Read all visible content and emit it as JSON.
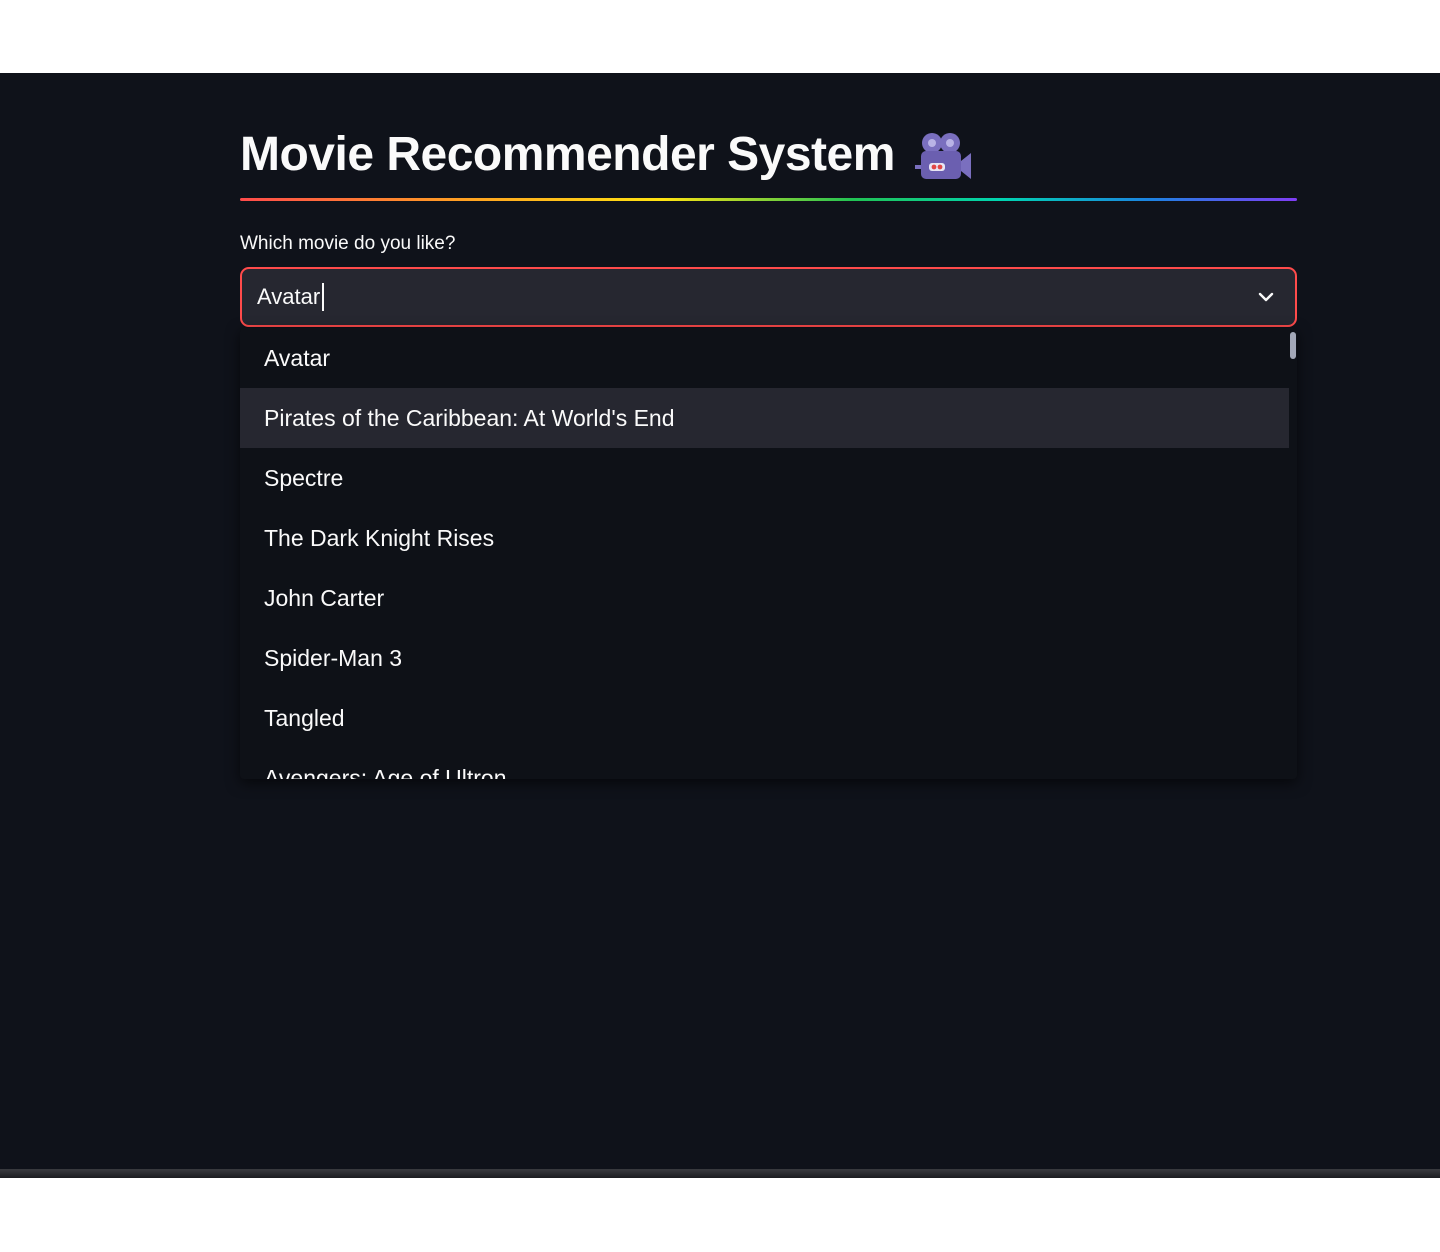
{
  "app": {
    "title": "Movie Recommender System",
    "title_icon": "movie-camera-icon"
  },
  "form": {
    "label": "Which movie do you like?",
    "selected_value": "Avatar"
  },
  "dropdown": {
    "options": [
      "Avatar",
      "Pirates of the Caribbean: At World's End",
      "Spectre",
      "The Dark Knight Rises",
      "John Carter",
      "Spider-Man 3",
      "Tangled",
      "Avengers: Age of Ultron"
    ],
    "highlighted_option": "Pirates of the Caribbean: At World's End"
  },
  "colors": {
    "background": "#0f121a",
    "input_border": "#ff4b4b",
    "input_bg": "#262730",
    "text": "#fafafa"
  }
}
